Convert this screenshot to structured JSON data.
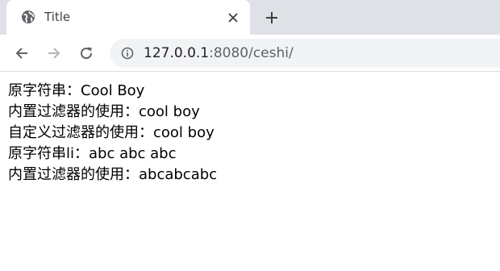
{
  "tab": {
    "title": "Title",
    "favicon_icon": "globe-icon",
    "close_icon": "close-icon"
  },
  "new_tab_icon": "plus-icon",
  "toolbar": {
    "back_icon": "arrow-left-icon",
    "forward_icon": "arrow-right-icon",
    "reload_icon": "reload-icon",
    "site_info_icon": "info-icon",
    "url_host": "127.0.0.1",
    "url_rest": ":8080/ceshi/"
  },
  "content": {
    "lines": [
      "原字符串：Cool Boy",
      "内置过滤器的使用：cool boy",
      "自定义过滤器的使用：cool boy",
      "原字符串li：abc abc abc",
      "内置过滤器的使用：abcabcabc"
    ]
  },
  "colors": {
    "tabstrip_bg": "#dee1e6",
    "omnibox_bg": "#f1f3f4",
    "icon": "#5f6368"
  }
}
